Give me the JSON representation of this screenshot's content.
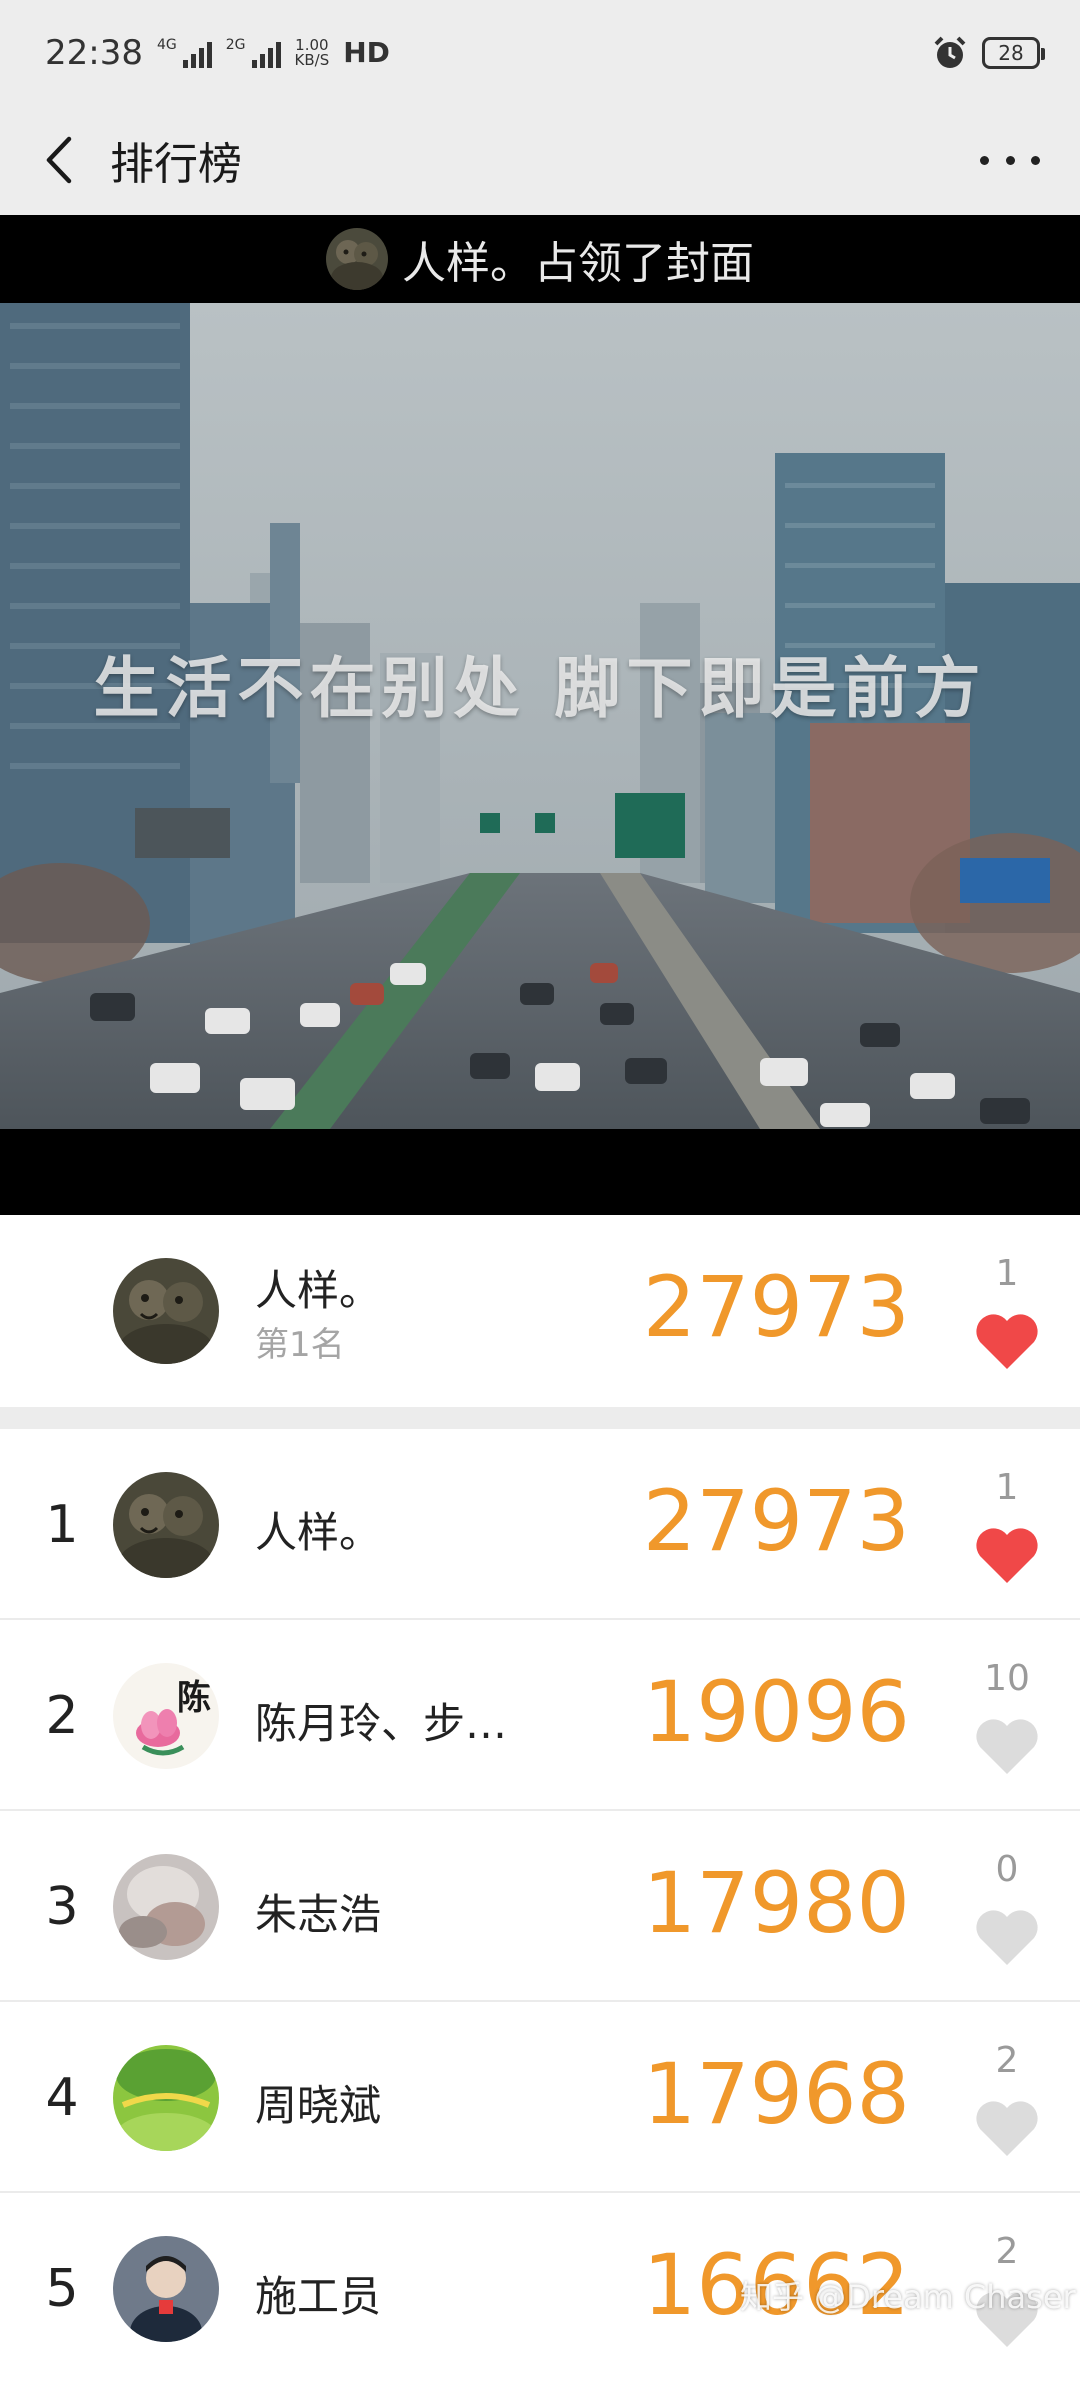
{
  "status_bar": {
    "time": "22:38",
    "signal1": "4G",
    "signal2": "2G",
    "speed_value": "1.00",
    "speed_unit": "KB/S",
    "hd": "HD",
    "battery": "28"
  },
  "app_bar": {
    "title": "排行榜"
  },
  "cover": {
    "header_text": "人样。占领了封面",
    "caption": "生活不在别处  脚下即是前方"
  },
  "top_card": {
    "name": "人样。",
    "subtitle": "第1名",
    "score": "27973",
    "likes": "1",
    "liked": true
  },
  "ranking": [
    {
      "rank": "1",
      "name": "人样。",
      "score": "27973",
      "likes": "1",
      "liked": true
    },
    {
      "rank": "2",
      "name": "陈月玲、步…",
      "score": "19096",
      "likes": "10",
      "liked": false
    },
    {
      "rank": "3",
      "name": "朱志浩",
      "score": "17980",
      "likes": "0",
      "liked": false
    },
    {
      "rank": "4",
      "name": "周晓斌",
      "score": "17968",
      "likes": "2",
      "liked": false
    },
    {
      "rank": "5",
      "name": "施工员",
      "score": "16662",
      "likes": "2",
      "liked": false
    }
  ],
  "watermark": "知乎 @Dream Chaser",
  "colors": {
    "score": "#f0982b",
    "heart_active": "#f04848",
    "heart_inactive": "#dcdcdc"
  }
}
